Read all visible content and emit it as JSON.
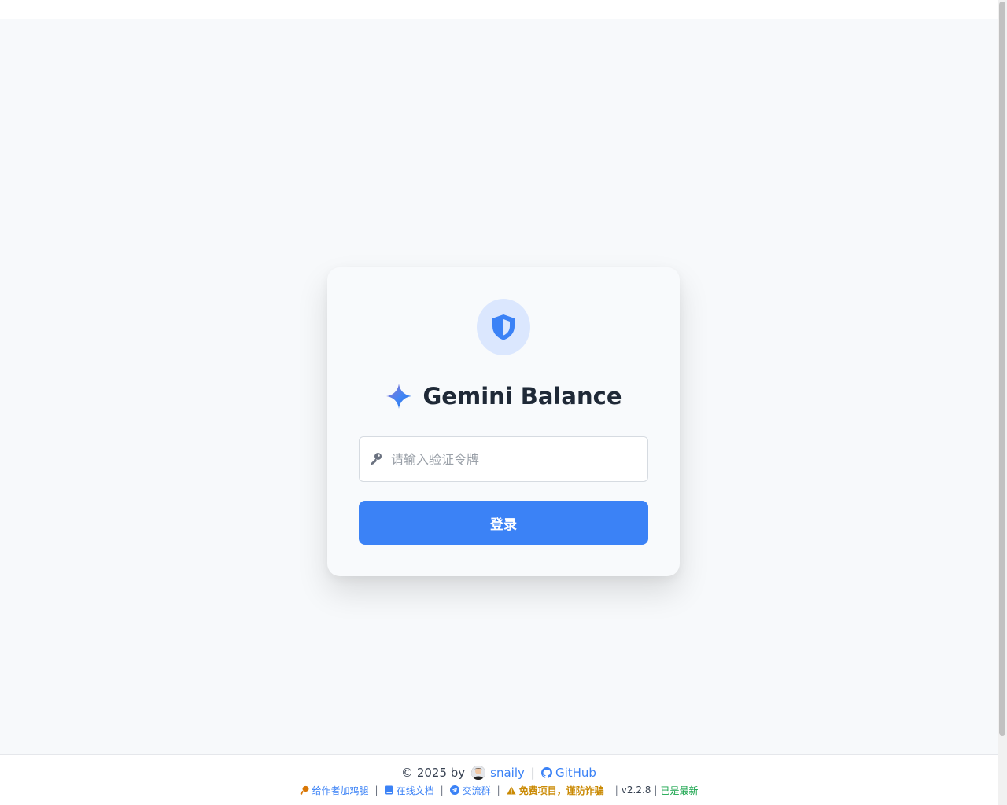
{
  "app": {
    "title": "Gemini Balance"
  },
  "login": {
    "token_placeholder": "请输入验证令牌",
    "token_value": "",
    "submit_label": "登录"
  },
  "footer": {
    "copyright": "© 2025 by",
    "author_name": "snaily",
    "github_label": "GitHub",
    "donate_label": "给作者加鸡腿",
    "docs_label": "在线文档",
    "community_label": "交流群",
    "warning_label": "免费项目，谨防诈骗",
    "version": "v2.2.8",
    "update_status": "已是最新"
  },
  "colors": {
    "accent": "#3b82f6",
    "page_bg": "#f7f9fb",
    "card_bg": "#f8fafc",
    "shield_bg": "#dbe7fe",
    "warning": "#ca8a04",
    "success": "#16a34a"
  },
  "icons": {
    "logo": "shield-icon",
    "brand": "gemini-sparkle-icon",
    "input": "key-icon",
    "author": "avatar",
    "github": "github-icon",
    "donate": "drumstick-icon",
    "docs": "book-icon",
    "community": "telegram-icon",
    "warning": "warning-icon"
  }
}
